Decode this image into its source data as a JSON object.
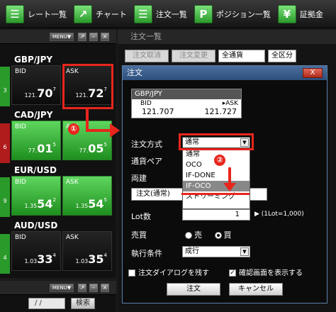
{
  "toolbar": {
    "items": [
      {
        "icon": "rate-list-icon",
        "glyph": "☰",
        "label": "レート一覧"
      },
      {
        "icon": "chart-icon",
        "glyph": "↗",
        "label": "チャート"
      },
      {
        "icon": "order-list-icon",
        "glyph": "☰",
        "label": "注文一覧"
      },
      {
        "icon": "position-icon",
        "glyph": "P",
        "label": "ポジション一覧"
      },
      {
        "icon": "margin-icon",
        "glyph": "¥",
        "label": "証拠金"
      }
    ]
  },
  "left_panel": {
    "menu_label": "MENU▼",
    "pairs": [
      {
        "name": "GBP/JPY",
        "bid_label": "BID",
        "ask_label": "ASK",
        "bid_small": "121.",
        "bid_big": "70",
        "bid_sup": "7",
        "ask_small": "121.",
        "ask_big": "72",
        "ask_sup": "7",
        "edge": "3"
      },
      {
        "name": "CAD/JPY",
        "bid_label": "BID",
        "ask_label": "ASK",
        "bid_small": "77.",
        "bid_big": "01",
        "bid_sup": "5",
        "ask_small": "77.",
        "ask_big": "05",
        "ask_sup": "5",
        "edge": "6"
      },
      {
        "name": "EUR/USD",
        "bid_label": "BID",
        "ask_label": "ASK",
        "bid_small": "1.35",
        "bid_big": "54",
        "bid_sup": "2",
        "ask_small": "1.35",
        "ask_big": "54",
        "ask_sup": "5",
        "edge": "9"
      },
      {
        "name": "AUD/USD",
        "bid_label": "BID",
        "ask_label": "ASK",
        "bid_small": "1.03",
        "bid_big": "33",
        "bid_sup": "4",
        "ask_small": "1.03",
        "ask_big": "35",
        "ask_sup": "4",
        "edge": "4"
      }
    ],
    "date_placeholder": "/    /",
    "search_label": "検索"
  },
  "order_list": {
    "title": "注文一覧",
    "cancel_label": "注文取消",
    "change_label": "注文変更",
    "currency_select": "全通貨",
    "type_select": "全区分"
  },
  "dialog": {
    "title": "注文",
    "close_label": "X",
    "price_pair": "GBP/JPY",
    "bid_label": "BID",
    "ask_label": "▸ASK",
    "bid_value": "121.707",
    "ask_value": "121.727",
    "method_label": "注文方式",
    "method_value": "通常",
    "method_options": [
      "通常",
      "OCO",
      "IF-DONE",
      "IF-OCO",
      "ストリーミング"
    ],
    "method_selected_index": 3,
    "currency_label": "通貨ペア",
    "hedge_label": "両建",
    "order_type_text": "注文(通常)",
    "lot_label": "Lot数",
    "lot_value": "1",
    "lot_note": "(1Lot=1,000)",
    "side_label": "売買",
    "sell_label": "売",
    "buy_label": "買",
    "exec_label": "執行条件",
    "exec_value": "成行",
    "keep_dialog_label": "注文ダイアログを残す",
    "confirm_label": "確認画面を表示する",
    "order_button": "注文",
    "cancel_button": "キャンセル"
  },
  "annotations": {
    "marker1": "①",
    "marker2": "②"
  },
  "colors": {
    "highlight": "#e8261c",
    "tile_green": "#3cb53c",
    "dialog_title": "#3d5f8c"
  }
}
